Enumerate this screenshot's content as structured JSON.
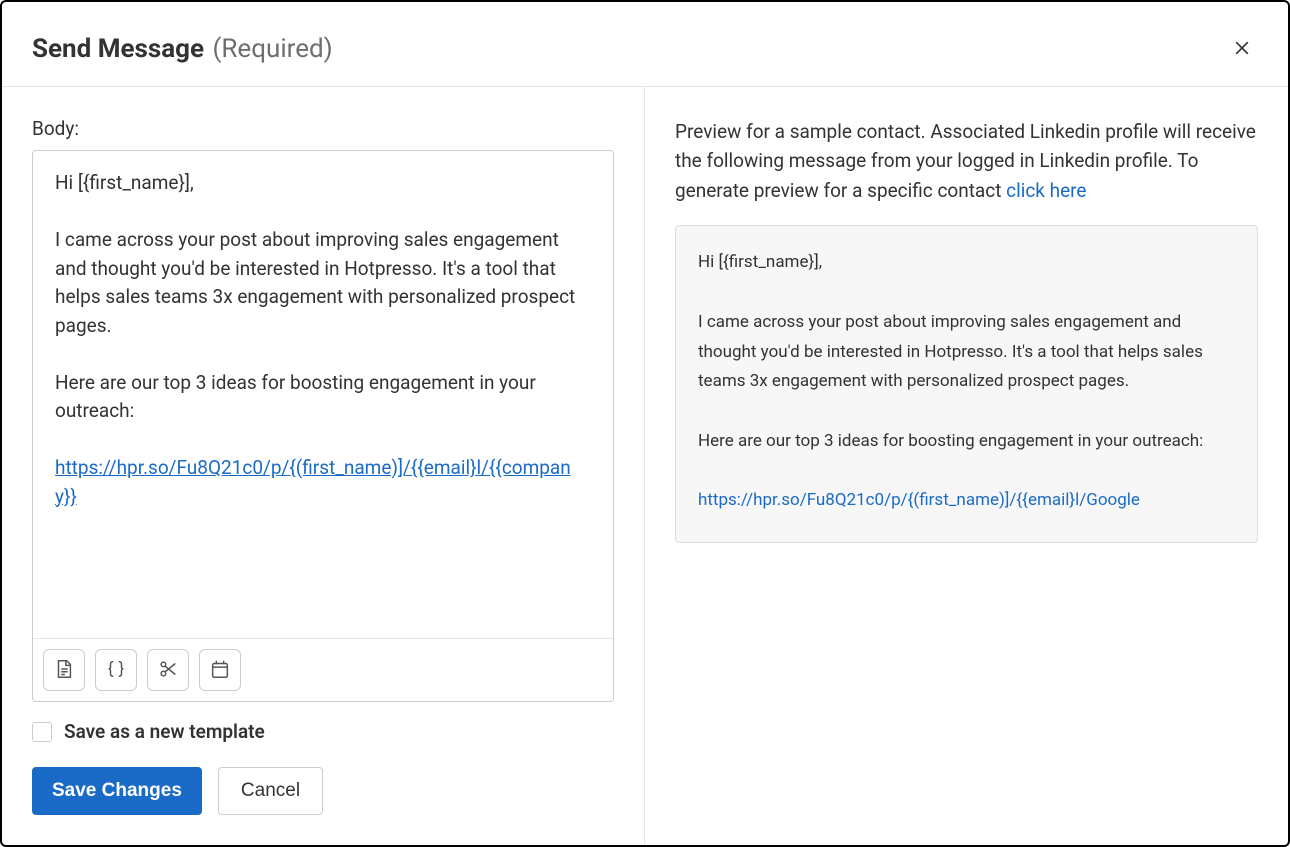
{
  "header": {
    "title": "Send Message",
    "required_suffix": "(Required)"
  },
  "body_label": "Body:",
  "editor": {
    "greeting": "Hi [{first_name}],",
    "para1": "I came across your post about improving sales engagement and thought you'd be interested in Hotpresso. It's a tool that helps sales teams 3x engagement with personalized prospect pages.",
    "para2": "Here are our top 3 ideas for boosting engagement in your outreach:",
    "link_text": "https://hpr.so/Fu8Q21c0/p/{(first_name)]/{{email}l/{{company}}"
  },
  "template_checkbox_label": "Save as a new template",
  "buttons": {
    "save": "Save Changes",
    "cancel": "Cancel"
  },
  "preview": {
    "intro_text": "Preview for a sample contact. Associated Linkedin profile will receive the following message from your logged in Linkedin profile. To generate preview for a specific contact ",
    "intro_link": "click here",
    "greeting": "Hi [{first_name}],",
    "para1": "I came across your post about improving sales engagement and thought you'd be interested in Hotpresso. It's a tool that helps sales teams 3x engagement with personalized prospect pages.",
    "para2": "Here are our top 3 ideas for boosting engagement in your outreach:",
    "link_text": "https://hpr.so/Fu8Q21c0/p/{(first_name)]/{{email}l/Google"
  }
}
